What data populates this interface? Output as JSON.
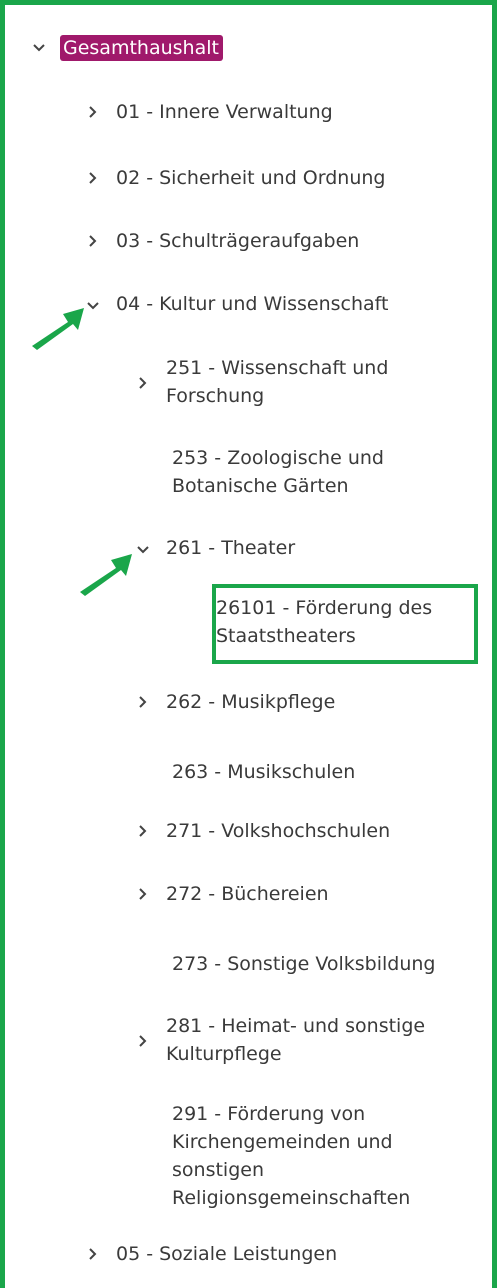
{
  "colors": {
    "frame": "#1aa64a",
    "root_badge_bg": "#a0196b",
    "root_badge_text": "#ffffff",
    "arrow": "#1aa64a",
    "text": "#3a3a3a",
    "chevron": "#444444"
  },
  "tree": {
    "root": {
      "label": "Gesamthaushalt",
      "state": "expanded",
      "icon": "chevron-down-icon"
    },
    "level1": [
      {
        "label": "01 - Innere Verwaltung",
        "state": "collapsed",
        "icon": "chevron-right-icon"
      },
      {
        "label": "02 - Sicherheit und Ordnung",
        "state": "collapsed",
        "icon": "chevron-right-icon"
      },
      {
        "label": "03 - Schulträgeraufgaben",
        "state": "collapsed",
        "icon": "chevron-right-icon"
      },
      {
        "label": "04 - Kultur und Wissenschaft",
        "state": "expanded",
        "icon": "chevron-down-icon"
      },
      {
        "label": "05 - Soziale Leistungen",
        "state": "collapsed",
        "icon": "chevron-right-icon"
      }
    ],
    "level2": [
      {
        "label": "251 - Wissenschaft und\nForschung",
        "state": "collapsed",
        "icon": "chevron-right-icon"
      },
      {
        "label": "253 - Zoologische und\nBotanische Gärten",
        "state": "leaf"
      },
      {
        "label": "261 - Theater",
        "state": "expanded",
        "icon": "chevron-down-icon"
      },
      {
        "label": "262 - Musikpflege",
        "state": "collapsed",
        "icon": "chevron-right-icon"
      },
      {
        "label": "263 - Musikschulen",
        "state": "leaf"
      },
      {
        "label": "271 - Volkshochschulen",
        "state": "collapsed",
        "icon": "chevron-right-icon"
      },
      {
        "label": "272 - Büchereien",
        "state": "collapsed",
        "icon": "chevron-right-icon"
      },
      {
        "label": "273 - Sonstige Volksbildung",
        "state": "leaf"
      },
      {
        "label": "281 - Heimat- und sonstige\nKulturpflege",
        "state": "collapsed",
        "icon": "chevron-right-icon"
      },
      {
        "label": "291 - Förderung von\nKirchengemeinden und\nsonstigen\nReligionsgemeinschaften",
        "state": "leaf"
      }
    ],
    "level3": [
      {
        "label": "26101 - Förderung des\nStaatstheaters",
        "state": "leaf",
        "highlighted": true
      }
    ]
  },
  "annotations": {
    "arrows": [
      {
        "icon": "green-arrow-icon",
        "points_to": "04 - Kultur und Wissenschaft"
      },
      {
        "icon": "green-arrow-icon",
        "points_to": "261 - Theater"
      }
    ]
  }
}
